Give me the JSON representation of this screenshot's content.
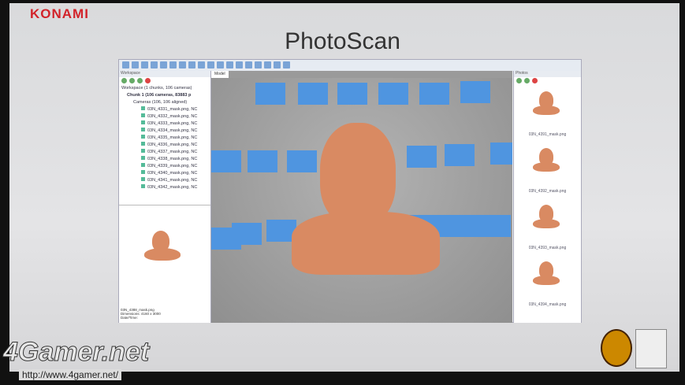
{
  "slide": {
    "brand": "KONAMI",
    "title": "PhotoScan"
  },
  "workspace": {
    "panel_title": "Workspace",
    "root": "Workspace (1 chunks, 106 cameras)",
    "chunk": "Chunk 1 (106 cameras, 83883 p",
    "cameras": "Cameras (106, 106 aligned)",
    "items": [
      "03N_4331_mask.png, NC",
      "03N_4332_mask.png, NC",
      "03N_4333_mask.png, NC",
      "03N_4334_mask.png, NC",
      "03N_4335_mask.png, NC",
      "03N_4336_mask.png, NC",
      "03N_4337_mask.png, NC",
      "03N_4338_mask.png, NC",
      "03N_4339_mask.png, NC",
      "03N_4340_mask.png, NC",
      "03N_4341_mask.png, NC",
      "03N_4342_mask.png, NC"
    ],
    "preview_name": "03N_4388_mask.png",
    "preview_dims": "Dimensions: 4160 x 3000",
    "preview_date": "Date/Time:"
  },
  "model": {
    "tab": "Model"
  },
  "photos": {
    "panel_title": "Photos",
    "items": [
      "03N_4391_mask.png",
      "03N_4392_mask.png",
      "03N_4393_mask.png",
      "03N_4394_mask.png"
    ]
  },
  "watermark": {
    "site": "4Gamer.net",
    "url": "http://www.4gamer.net/"
  }
}
